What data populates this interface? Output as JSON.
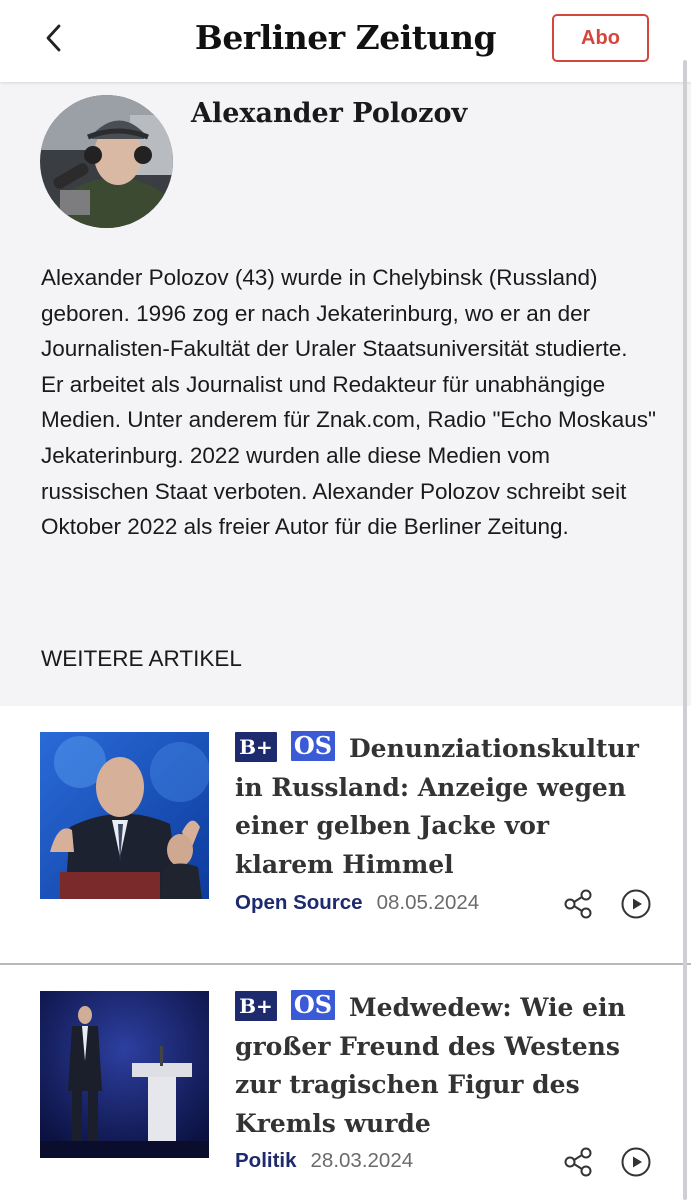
{
  "header": {
    "back_icon": "chevron-left-icon",
    "logo_text": "Berliner Zeitung",
    "subscribe_label": "Abo",
    "accent_color": "#d4473d"
  },
  "author": {
    "name": "Alexander Polozov",
    "bio": "Alexander Polozov (43) wurde in Chelybinsk (Russland) geboren. 1996 zog er nach Jekaterinburg, wo er an der Journalisten-Fakultät der Uraler Staatsuniversität studierte. Er arbeitet als Journalist und Redakteur für unabhängige Medien. Unter anderem für Znak.com, Radio \"Echo Moskaus\" Jekaterinburg. 2022 wurden alle diese Medien vom russischen Staat verboten. Alexander Polozov schreibt seit Oktober 2022 als freier Autor für die Berliner Zeitung."
  },
  "more_articles_heading": "WEITERE ARTIKEL",
  "articles": [
    {
      "badge_plus": "B+",
      "badge_os": "OS",
      "title": "Denunziationskultur in Russland: Anzeige wegen einer gelben Jacke vor klarem Himmel",
      "category": "Open Source",
      "date": "08.05.2024",
      "share_icon": "share-icon",
      "play_icon": "play-circle-icon"
    },
    {
      "badge_plus": "B+",
      "badge_os": "OS",
      "title": "Medwedew: Wie ein großer Freund des Westens zur tragischen Figur des Kremls wurde",
      "category": "Politik",
      "date": "28.03.2024",
      "share_icon": "share-icon",
      "play_icon": "play-circle-icon"
    }
  ],
  "colors": {
    "brand_navy": "#1d2a6e",
    "os_blue": "#3b5bd6",
    "section_bg": "#f4f4f6"
  }
}
